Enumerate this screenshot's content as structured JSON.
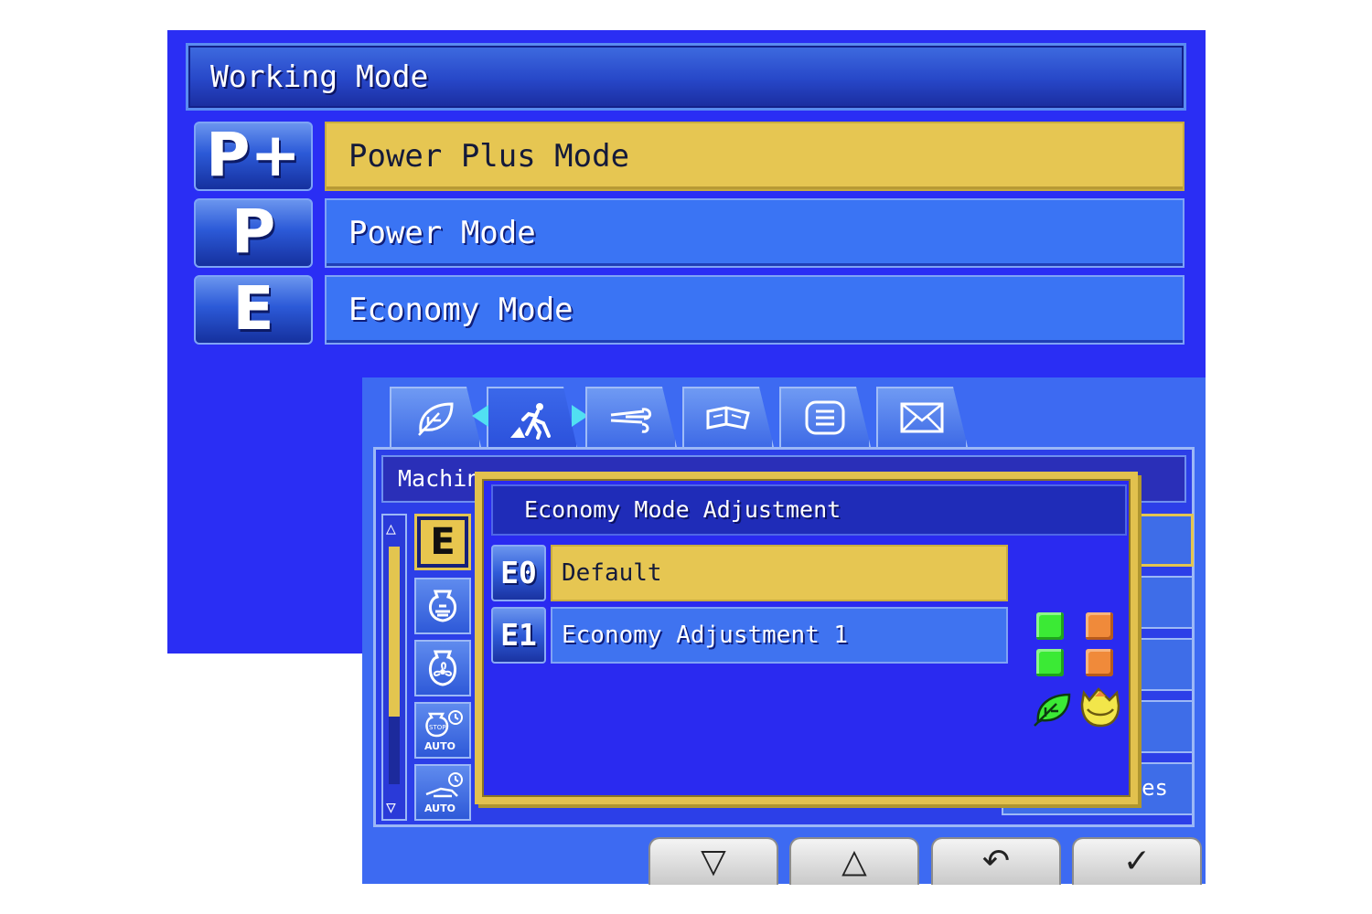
{
  "working_mode": {
    "title": "Working Mode",
    "modes": [
      {
        "badge": "P+",
        "label": "Power Plus Mode",
        "selected": true
      },
      {
        "badge": "P",
        "label": "Power Mode",
        "selected": false
      },
      {
        "badge": "E",
        "label": "Economy Mode",
        "selected": false
      }
    ]
  },
  "machine_screen": {
    "tabs": [
      "leaf-icon",
      "machine-worker-icon",
      "wind-icon",
      "manual-book-icon",
      "list-icon",
      "mail-icon"
    ],
    "active_tab": "machine-worker-icon",
    "header_partial": "Machin",
    "side_icons": [
      {
        "name": "economy-e-icon",
        "text": "E",
        "selected": true
      },
      {
        "name": "engine-rpm-icon",
        "selected": false
      },
      {
        "name": "engine-fan-icon",
        "selected": false
      },
      {
        "name": "auto-stop-icon",
        "text": "AUTO",
        "selected": false
      },
      {
        "name": "auto-idle-icon",
        "text": "AUTO",
        "selected": false
      }
    ],
    "right_fragment": "es"
  },
  "dialog": {
    "title": "Economy Mode Adjustment",
    "options": [
      {
        "badge": "E0",
        "label": "Default",
        "selected": true
      },
      {
        "badge": "E1",
        "label": "Economy Adjustment 1",
        "selected": false
      }
    ],
    "indicators": {
      "left_column": [
        "green",
        "green"
      ],
      "right_column": [
        "orange",
        "orange"
      ],
      "left_icon": "leaf-icon",
      "right_icon": "fuel-tank-icon"
    },
    "colors": {
      "green": "#3bea35",
      "orange": "#f08a3a",
      "gold": "#e2c14e"
    }
  },
  "softkeys": [
    {
      "name": "down",
      "symbol": "▽"
    },
    {
      "name": "up",
      "symbol": "△"
    },
    {
      "name": "back",
      "symbol": "↶"
    },
    {
      "name": "confirm",
      "symbol": "✓"
    }
  ]
}
